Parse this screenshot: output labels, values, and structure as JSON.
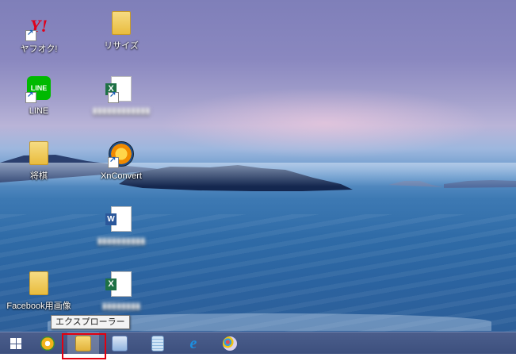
{
  "desktop": {
    "icons": [
      {
        "label": "ヤフオク!",
        "icon": "yahoo-auction-icon",
        "shortcut": true
      },
      {
        "label": "リサイズ",
        "icon": "folder-icon",
        "shortcut": false
      },
      {
        "label": "LINE",
        "icon": "line-app-icon",
        "shortcut": true
      },
      {
        "label": "",
        "icon": "excel-file-icon",
        "shortcut": true,
        "label_blurred": true
      },
      {
        "label": "将棋",
        "icon": "folder-icon",
        "shortcut": false
      },
      {
        "label": "XnConvert",
        "icon": "xnconvert-icon",
        "shortcut": true
      },
      {
        "label": "",
        "icon": "word-file-icon",
        "shortcut": false,
        "label_blurred": true
      },
      {
        "label": "Facebook用画像",
        "icon": "folder-icon",
        "shortcut": false
      },
      {
        "label": "",
        "icon": "excel-file-icon",
        "shortcut": false,
        "label_blurred": true
      }
    ]
  },
  "taskbar": {
    "start_icon": "windows-start-icon",
    "apps": [
      {
        "icon": "sync-arrows-icon",
        "color": "#f2b21b"
      },
      {
        "icon": "file-explorer-icon",
        "color": "#e9c04a",
        "active": true
      },
      {
        "icon": "window-switcher-icon",
        "color": "#a9c3e6"
      },
      {
        "icon": "notepad-icon",
        "color": "#8fb9e0"
      },
      {
        "icon": "internet-explorer-icon",
        "color": "#1c8fe0"
      },
      {
        "icon": "paint-icon",
        "color": "#c7b9e8"
      }
    ]
  },
  "tooltip": {
    "text": "エクスプローラー"
  },
  "highlight": {
    "color": "#e3000f",
    "target": "file-explorer-icon"
  }
}
